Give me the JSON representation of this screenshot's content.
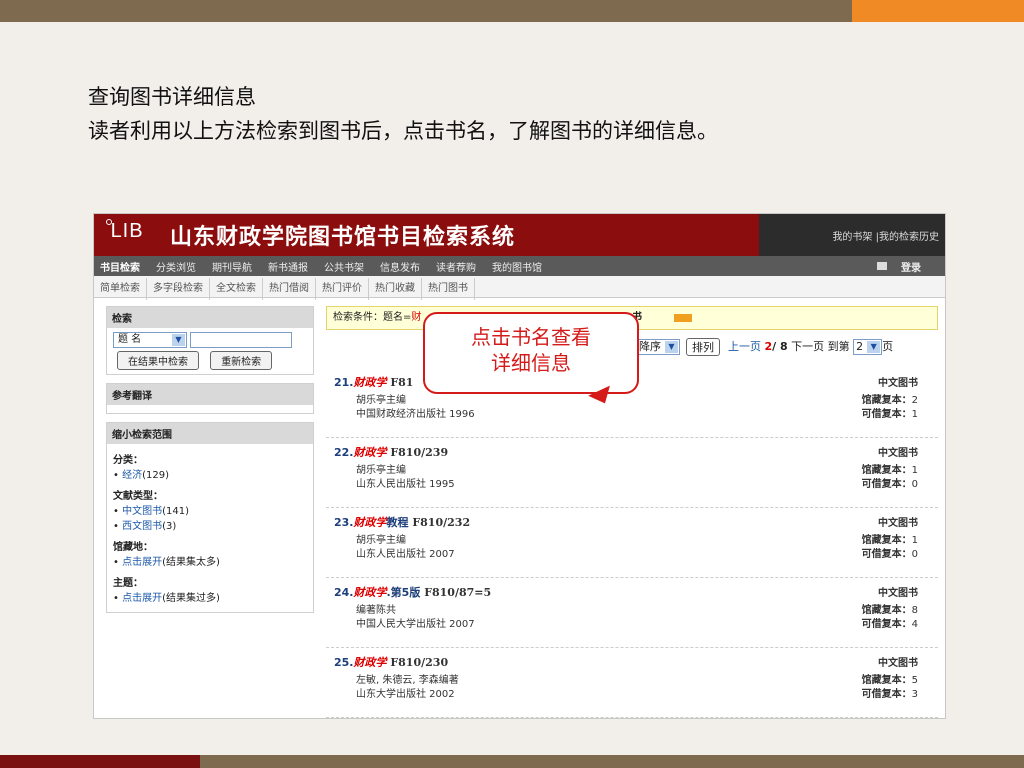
{
  "slide": {
    "title": "查询图书详细信息",
    "subtitle": "读者利用以上方法检索到图书后，点击书名，了解图书的详细信息。"
  },
  "app": {
    "logo": "LIB",
    "title": "山东财政学院图书馆书目检索系统",
    "top_links": "我的书架 |我的检索历史"
  },
  "nav": {
    "items": [
      "书目检索",
      "分类浏览",
      "期刊导航",
      "新书通报",
      "公共书架",
      "信息发布",
      "读者荐购",
      "我的图书馆"
    ],
    "login": "登录"
  },
  "subnav": [
    "简单检索",
    "多字段检索",
    "全文检索",
    "热门借阅",
    "热门评价",
    "热门收藏",
    "热门图书"
  ],
  "search_box": {
    "header": "检索",
    "field": "题 名",
    "search_in_results": "在结果中检索",
    "research": "重新检索"
  },
  "reference": {
    "header": "参考翻译"
  },
  "narrow": {
    "header": "缩小检索范围",
    "class_title": "分类：",
    "class_item": "经济",
    "class_count": "(129)",
    "type_title": "文献类型：",
    "type_items": [
      {
        "label": "中文图书",
        "count": "(141)"
      },
      {
        "label": "西文图书",
        "count": "(3)"
      }
    ],
    "loc_title": "馆藏地：",
    "loc_link": "点击展开",
    "loc_note": "(结果集太多)",
    "subject_title": "主题：",
    "subject_link": "点击展开",
    "subject_note": "(结果集过多)"
  },
  "condition": {
    "prefix": "检索条件：题名=",
    "keyword": "财",
    "tail": "书"
  },
  "pager": {
    "order": "降序",
    "sort_btn": "排列",
    "prev": "上一页",
    "current": "2",
    "total": "/ 8",
    "next": "下一页",
    "goto": "到第",
    "page_value": "2",
    "page_unit": "页"
  },
  "results": [
    {
      "num": "21.",
      "hl": "财政学",
      "rest": "",
      "call": "F81",
      "author": "胡乐亭主编",
      "pub": "中国财政经济出版社 1996",
      "type": "中文图书",
      "hold_label": "馆藏复本：",
      "hold": "2",
      "avail_label": "可借复本：",
      "avail": "1"
    },
    {
      "num": "22.",
      "hl": "财政学",
      "rest": "",
      "call": "F810/239",
      "author": "胡乐亭主编",
      "pub": "山东人民出版社 1995",
      "type": "中文图书",
      "hold_label": "馆藏复本：",
      "hold": "1",
      "avail_label": "可借复本：",
      "avail": "0"
    },
    {
      "num": "23.",
      "hl": "财政学",
      "rest": "教程",
      "call": "F810/232",
      "author": "胡乐亭主编",
      "pub": "山东人民出版社 2007",
      "type": "中文图书",
      "hold_label": "馆藏复本：",
      "hold": "1",
      "avail_label": "可借复本：",
      "avail": "0"
    },
    {
      "num": "24.",
      "hl": "财政学",
      "rest": ".第5版",
      "call": "F810/87=5",
      "author": "编著陈共",
      "pub": "中国人民大学出版社 2007",
      "type": "中文图书",
      "hold_label": "馆藏复本：",
      "hold": "8",
      "avail_label": "可借复本：",
      "avail": "4"
    },
    {
      "num": "25.",
      "hl": "财政学",
      "rest": "",
      "call": "F810/230",
      "author": "左敏, 朱德云, 李森编著",
      "pub": "山东大学出版社 2002",
      "type": "中文图书",
      "hold_label": "馆藏复本：",
      "hold": "5",
      "avail_label": "可借复本：",
      "avail": "3"
    }
  ],
  "callout": {
    "line1": "点击书名查看",
    "line2": "详细信息"
  }
}
